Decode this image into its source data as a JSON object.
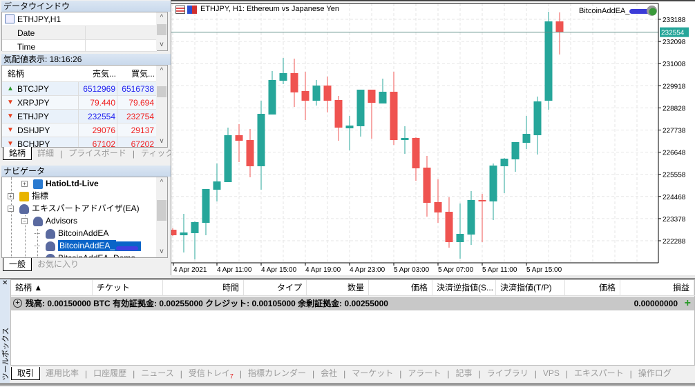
{
  "data_window": {
    "title": "データウインドウ",
    "symbol": "ETHJPY,H1",
    "rows": [
      {
        "label": "Date",
        "value": ""
      },
      {
        "label": "Time",
        "value": ""
      }
    ]
  },
  "market_watch": {
    "title": "気配値表示: 18:16:26",
    "columns": [
      "銘柄",
      "売気...",
      "買気..."
    ],
    "rows": [
      {
        "symbol": "BTCJPY",
        "bid": "6512969",
        "ask": "6516738",
        "dir": "up",
        "bid_color": "blue",
        "ask_color": "blue"
      },
      {
        "symbol": "XRPJPY",
        "bid": "79.440",
        "ask": "79.694",
        "dir": "down",
        "bid_color": "red",
        "ask_color": "red"
      },
      {
        "symbol": "ETHJPY",
        "bid": "232554",
        "ask": "232754",
        "dir": "down",
        "bid_color": "blue",
        "ask_color": "red"
      },
      {
        "symbol": "DSHJPY",
        "bid": "29076",
        "ask": "29137",
        "dir": "down",
        "bid_color": "red",
        "ask_color": "red"
      },
      {
        "symbol": "BCHJPY",
        "bid": "67102",
        "ask": "67202",
        "dir": "down",
        "bid_color": "red",
        "ask_color": "red"
      }
    ],
    "tabs": [
      "銘柄",
      "詳細",
      "プライスボード",
      "ティック"
    ],
    "active_tab": 0
  },
  "navigator": {
    "title": "ナビゲータ",
    "items": [
      {
        "label": "HatioLtd-Live",
        "icon": "server-icon",
        "bold": true
      },
      {
        "label": "指標",
        "icon": "indicator-icon"
      },
      {
        "label": "エキスパートアドバイザ(EA)",
        "icon": "expert-icon"
      },
      {
        "label": "Advisors",
        "icon": "expert-folder-icon"
      },
      {
        "label": "BitcoinAddEA",
        "icon": "expert-icon"
      },
      {
        "label": "BitcoinAddEA_",
        "icon": "expert-icon",
        "selected": true
      },
      {
        "label": "BitcoinAddEA_Demo",
        "icon": "expert-icon"
      }
    ],
    "tabs": [
      "一般",
      "お気に入り"
    ],
    "active_tab": 0
  },
  "chart": {
    "title": "ETHJPY, H1:  Ethereum vs Japanese Yen",
    "ea_label": "BitcoinAddEA_",
    "current_price": "232554",
    "colors": {
      "bull": "#26a69a",
      "bear": "#ef5350",
      "current_price_bg": "#26a69a"
    }
  },
  "chart_data": {
    "type": "candlestick",
    "symbol": "ETHJPY",
    "timeframe": "H1",
    "grid": true,
    "ylim": [
      221100,
      233800
    ],
    "yticks": [
      "233188",
      "232098",
      "231008",
      "229918",
      "228828",
      "227738",
      "226648",
      "225558",
      "224468",
      "223378",
      "222288"
    ],
    "xticks": [
      "4 Apr 2021",
      "4 Apr 11:00",
      "4 Apr 15:00",
      "4 Apr 19:00",
      "4 Apr 23:00",
      "5 Apr 03:00",
      "5 Apr 07:00",
      "5 Apr 11:00",
      "5 Apr 15:00"
    ],
    "columns": [
      "time",
      "open",
      "high",
      "low",
      "close"
    ],
    "candles": [
      [
        "4 Apr 07:00",
        222831,
        222900,
        222520,
        222560
      ],
      [
        "4 Apr 08:00",
        222560,
        223612,
        221711,
        222696
      ],
      [
        "4 Apr 09:00",
        222662,
        223239,
        221371,
        223205
      ],
      [
        "4 Apr 10:00",
        223171,
        224835,
        222560,
        224835
      ],
      [
        "4 Apr 11:00",
        224801,
        226091,
        224224,
        225208
      ],
      [
        "4 Apr 12:00",
        225174,
        227857,
        225174,
        227483
      ],
      [
        "4 Apr 13:00",
        227483,
        228027,
        226159,
        227212
      ],
      [
        "4 Apr 14:00",
        227245,
        227789,
        225412,
        225956
      ],
      [
        "4 Apr 15:00",
        225956,
        229181,
        224801,
        228536
      ],
      [
        "4 Apr 16:00",
        228502,
        230641,
        228502,
        230200
      ],
      [
        "4 Apr 17:00",
        230166,
        231287,
        229996,
        230540
      ],
      [
        "4 Apr 18:00",
        230540,
        231252,
        228876,
        229589
      ],
      [
        "4 Apr 19:00",
        229657,
        230607,
        228230,
        229181
      ],
      [
        "4 Apr 20:00",
        229181,
        230200,
        228943,
        229928
      ],
      [
        "4 Apr 21:00",
        229928,
        230370,
        228604,
        229181
      ],
      [
        "4 Apr 22:00",
        229215,
        229419,
        227212,
        227857
      ],
      [
        "4 Apr 23:00",
        227823,
        228434,
        226736,
        227959
      ],
      [
        "5 Apr 00:00",
        227925,
        229725,
        227415,
        229725
      ],
      [
        "5 Apr 01:00",
        229725,
        229725,
        227313,
        229079
      ],
      [
        "5 Apr 02:00",
        229045,
        230268,
        229045,
        229623
      ],
      [
        "5 Apr 03:00",
        229623,
        230607,
        227008,
        227245
      ],
      [
        "5 Apr 04:00",
        227245,
        227925,
        226566,
        227347
      ],
      [
        "5 Apr 05:00",
        227347,
        227381,
        225242,
        225854
      ],
      [
        "5 Apr 06:00",
        225888,
        226465,
        223476,
        224156
      ],
      [
        "5 Apr 07:00",
        224190,
        225310,
        223171,
        223680
      ],
      [
        "5 Apr 08:00",
        223714,
        224427,
        221949,
        222220
      ],
      [
        "5 Apr 09:00",
        222220,
        224122,
        221405,
        222628
      ],
      [
        "5 Apr 10:00",
        222594,
        224733,
        222085,
        224292
      ],
      [
        "5 Apr 11:00",
        224292,
        224597,
        222220,
        224224
      ],
      [
        "5 Apr 12:00",
        224224,
        226091,
        223306,
        225990
      ],
      [
        "5 Apr 13:00",
        225956,
        226363,
        224631,
        226329
      ],
      [
        "5 Apr 14:00",
        226295,
        226295,
        225684,
        227144
      ],
      [
        "5 Apr 15:00",
        227110,
        228434,
        226804,
        227551
      ],
      [
        "5 Apr 16:00",
        227483,
        229385,
        226533,
        229147
      ],
      [
        "5 Apr 17:00",
        229181,
        233561,
        228740,
        233086
      ],
      [
        "5 Apr 18:00",
        233086,
        233528,
        231456,
        232554
      ]
    ],
    "current_price": 232554
  },
  "toolbox": {
    "side_label": "ツールボックス",
    "columns": [
      "銘柄 ▲",
      "チケット",
      "時間",
      "タイプ",
      "数量",
      "価格",
      "決済逆指値(S...",
      "決済指値(T/P)",
      "価格",
      "損益"
    ],
    "balance_line": "残高: 0.00150000 BTC  有効証拠金: 0.00255000  クレジット: 0.00105000  余剰証拠金: 0.00255000",
    "profit": "0.00000000",
    "tabs": [
      {
        "label": "取引"
      },
      {
        "label": "運用比率"
      },
      {
        "label": "口座履歴"
      },
      {
        "label": "ニュース"
      },
      {
        "label": "受信トレイ",
        "badge": "7"
      },
      {
        "label": "指標カレンダー"
      },
      {
        "label": "会社"
      },
      {
        "label": "マーケット"
      },
      {
        "label": "アラート"
      },
      {
        "label": "記事"
      },
      {
        "label": "ライブラリ"
      },
      {
        "label": "VPS"
      },
      {
        "label": "エキスパート"
      },
      {
        "label": "操作ログ"
      }
    ],
    "active_tab": 0
  }
}
